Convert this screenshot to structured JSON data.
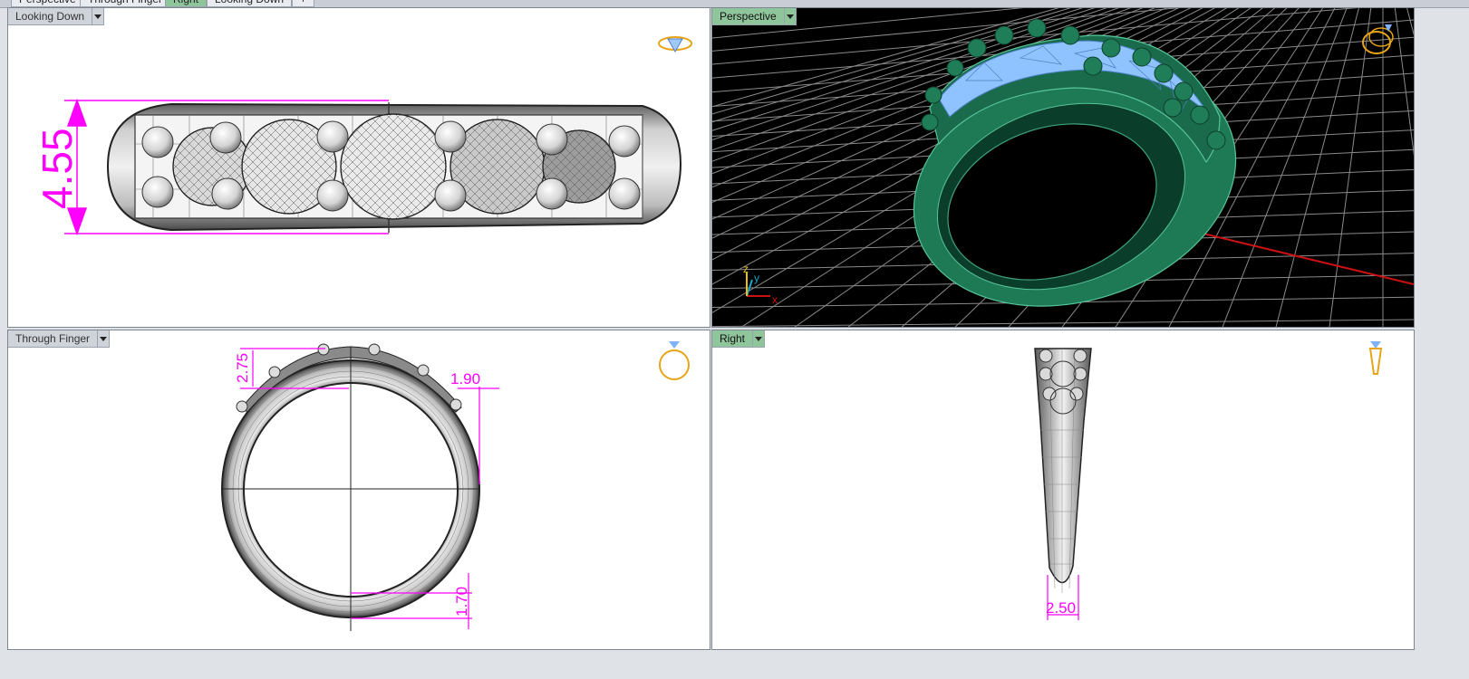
{
  "tabs": [
    "Perspective",
    "Through Finger",
    "Right",
    "Looking Down",
    "+"
  ],
  "viewports": {
    "looking_down": {
      "label": "Looking Down",
      "dimension": "4.55"
    },
    "perspective": {
      "label": "Perspective",
      "axis_x": "x",
      "axis_y": "y",
      "axis_z": "z"
    },
    "through_finger": {
      "label": "Through Finger",
      "dim_top": "2.75",
      "dim_side": "1.90",
      "dim_bottom": "1.70"
    },
    "right": {
      "label": "Right",
      "dimension": "2.50"
    }
  },
  "colors": {
    "dimension": "#ff00ff",
    "active_tab": "#8fc59a",
    "ring_green": "#1e7a55",
    "gem_blue": "#8fc3ff",
    "grid": "#9a9a9a",
    "axis_red": "#cc1111",
    "axis_cyan": "#17a7c9"
  },
  "icons": [
    "ring-top-icon",
    "ring-perspective-icon",
    "ring-front-icon",
    "ring-side-icon"
  ]
}
